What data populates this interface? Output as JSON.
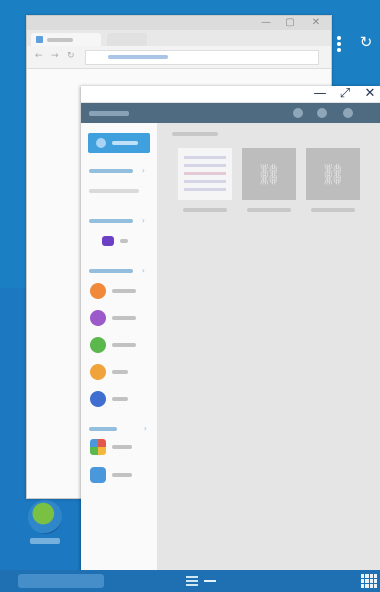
{
  "desktop": {
    "menu_icon": "vertical-dots-icon",
    "refresh_icon": "refresh-icon",
    "refresh_glyph": "↻",
    "shortcut_icon": "globe-app-icon"
  },
  "browser_window": {
    "minimize_glyph": "—",
    "maximize_glyph": "▢",
    "close_glyph": "✕",
    "back_glyph": "←",
    "forward_glyph": "→",
    "reload_glyph": "↻"
  },
  "file_manager": {
    "minimize_glyph": "—",
    "maximize_glyph": "⤢",
    "close_glyph": "✕",
    "sidebar": {
      "categories": [
        {
          "icon": "images-icon",
          "color": "#f08a3a"
        },
        {
          "icon": "videos-icon",
          "color": "#9b59c9"
        },
        {
          "icon": "music-icon",
          "color": "#5bb84c"
        },
        {
          "icon": "recent-icon",
          "color": "#f0a33a"
        },
        {
          "icon": "documents-icon",
          "color": "#3f6ed0"
        }
      ],
      "apps": [
        {
          "icon": "gallery-app-icon",
          "color": "#e2574c"
        },
        {
          "icon": "cloud-app-icon",
          "color": "#4a98db"
        }
      ],
      "device_icon": "sd-card-icon",
      "device_color": "#6c3fc4"
    },
    "thumbnail_glyph": "⛓"
  },
  "taskbar": {
    "list_icon": "task-list-icon",
    "minimize_icon": "minimize-all-icon",
    "apps_icon": "apps-grid-icon"
  },
  "colors": {
    "desktop_blue": "#1b7fc4",
    "toolbar": "#4f6b81",
    "accent": "#3fa0dd"
  }
}
